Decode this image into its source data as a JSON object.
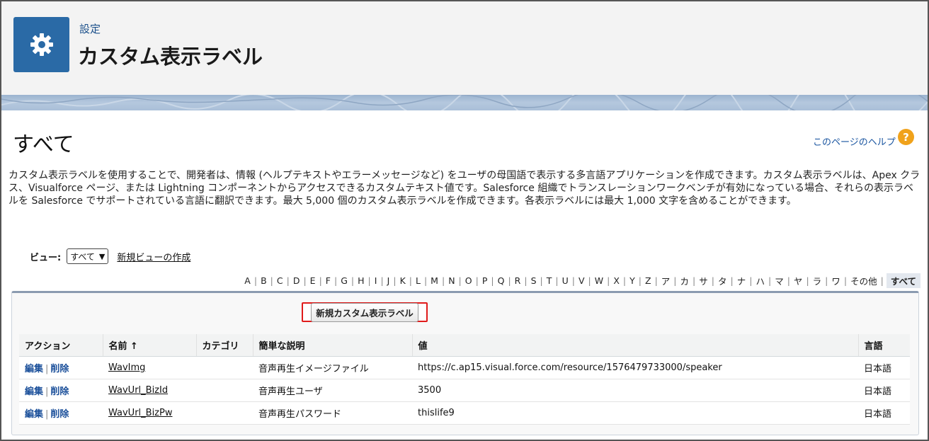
{
  "header": {
    "breadcrumb": "設定",
    "title": "カスタム表示ラベル"
  },
  "section": {
    "title": "すべて",
    "help_link": "このページのヘルプ",
    "help_icon": "?",
    "description": "カスタム表示ラベルを使用することで、開発者は、情報 (ヘルプテキストやエラーメッセージなど) をユーザの母国語で表示する多言語アプリケーションを作成できます。カスタム表示ラベルは、Apex クラス、Visualforce ページ、または Lightning コンポーネントからアクセスできるカスタムテキスト値です。Salesforce 組織でトランスレーションワークベンチが有効になっている場合、それらの表示ラベルを Salesforce でサポートされている言語に翻訳できます。最大 5,000 個のカスタム表示ラベルを作成できます。各表示ラベルには最大 1,000 文字を含めることができます。"
  },
  "view": {
    "label": "ビュー:",
    "selected": "すべて",
    "create_link": "新規ビューの作成"
  },
  "alphabet": [
    "A",
    "B",
    "C",
    "D",
    "E",
    "F",
    "G",
    "H",
    "I",
    "J",
    "K",
    "L",
    "M",
    "N",
    "O",
    "P",
    "Q",
    "R",
    "S",
    "T",
    "U",
    "V",
    "W",
    "X",
    "Y",
    "Z",
    "ア",
    "カ",
    "サ",
    "タ",
    "ナ",
    "ハ",
    "マ",
    "ヤ",
    "ラ",
    "ワ",
    "その他",
    "すべて"
  ],
  "new_button": "新規カスタム表示ラベル",
  "table": {
    "headers": [
      "アクション",
      "名前 ↑",
      "カテゴリ",
      "簡単な説明",
      "値",
      "言語"
    ],
    "rows": [
      {
        "edit": "編集",
        "delete": "削除",
        "name": "WavImg",
        "category": "",
        "description": "音声再生イメージファイル",
        "value": "https://c.ap15.visual.force.com/resource/1576479733000/speaker",
        "language": "日本語"
      },
      {
        "edit": "編集",
        "delete": "削除",
        "name": "WavUrl_BizId",
        "category": "",
        "description": "音声再生ユーザ",
        "value": "3500",
        "language": "日本語"
      },
      {
        "edit": "編集",
        "delete": "削除",
        "name": "WavUrl_BizPw",
        "category": "",
        "description": "音声再生パスワード",
        "value": "thislife9",
        "language": "日本語"
      }
    ]
  },
  "colors": {
    "tile": "#2a6aa6",
    "link": "#1a55a0",
    "highlight": "#e01b1b",
    "help": "#f0a21b"
  },
  "icons": {
    "tile": "gear-icon",
    "help": "help-icon",
    "select": "chevron-down-icon"
  }
}
